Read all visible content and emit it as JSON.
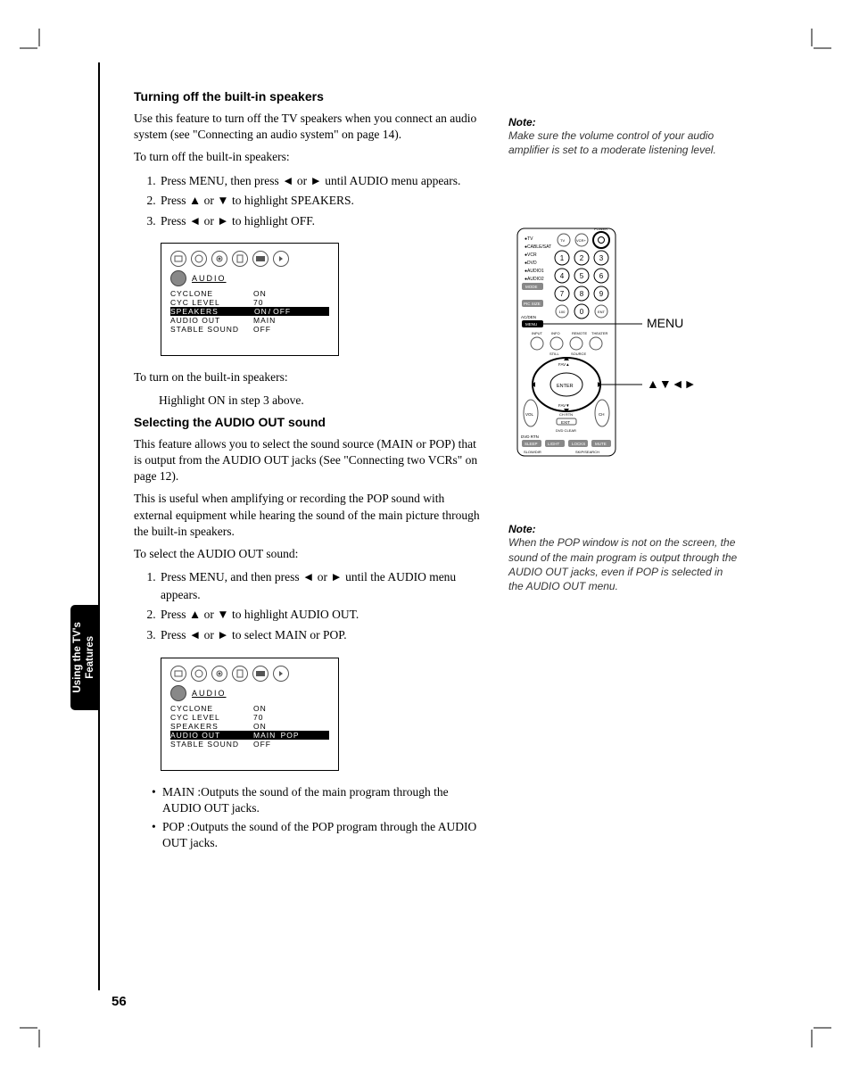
{
  "page_number": "56",
  "side_tab": "Using the TV's\nFeatures",
  "section1": {
    "heading": "Turning off the built-in speakers",
    "intro": "Use this feature to turn off the TV speakers when you connect an audio system (see \"Connecting an audio system\" on page 14).",
    "lead": "To turn off the built-in speakers:",
    "steps": [
      "Press MENU, then press ◄ or ► until AUDIO menu appears.",
      "Press ▲ or ▼ to highlight SPEAKERS.",
      "Press ◄ or ► to highlight OFF."
    ],
    "osd": {
      "title": "AUDIO",
      "rows": [
        {
          "label": "CYCLONE",
          "value": "ON"
        },
        {
          "label": "CYC LEVEL",
          "value": "70"
        },
        {
          "label": "SPEAKERS",
          "value_on": "ON",
          "value_off": "OFF",
          "row_hl": true,
          "off_hl": true
        },
        {
          "label": "AUDIO OUT",
          "value": "MAIN"
        },
        {
          "label": "STABLE SOUND",
          "value": "OFF"
        }
      ]
    },
    "turnon_lead": "To turn on the built-in speakers:",
    "turnon_step": "Highlight ON in step 3 above."
  },
  "section2": {
    "heading": "Selecting the AUDIO OUT sound",
    "p1": "This feature allows you to select the sound source (MAIN or POP) that is output from the AUDIO OUT jacks (See \"Connecting two VCRs\" on page 12).",
    "p2": "This is useful when amplifying or recording the POP sound with external equipment while hearing the sound of the main picture through the built-in speakers.",
    "lead": "To select the AUDIO OUT sound:",
    "steps": [
      "Press MENU, and then press ◄ or ► until the AUDIO menu appears.",
      "Press ▲ or ▼ to highlight AUDIO OUT.",
      "Press ◄ or ► to select MAIN or POP."
    ],
    "osd": {
      "title": "AUDIO",
      "rows": [
        {
          "label": "CYCLONE",
          "value": "ON"
        },
        {
          "label": "CYC LEVEL",
          "value": "70"
        },
        {
          "label": "SPEAKERS",
          "value": "ON"
        },
        {
          "label": "AUDIO OUT",
          "value_main": "MAIN",
          "value_pop": "POP",
          "row_hl": true,
          "pop_hl": true
        },
        {
          "label": "STABLE SOUND",
          "value": "OFF"
        }
      ]
    },
    "bullets": [
      {
        "term": "MAIN :",
        "desc": "Outputs the sound of the main program through the AUDIO OUT jacks."
      },
      {
        "term": "POP   :",
        "desc": "Outputs the sound of the POP program through the AUDIO OUT jacks."
      }
    ]
  },
  "note1": {
    "label": "Note:",
    "text": "Make sure the volume control of your audio amplifier is set to a moderate listening level."
  },
  "note2": {
    "label": "Note:",
    "text": "When the POP window is not on the screen, the sound of the main program is output through the AUDIO OUT jacks, even if POP is selected in the AUDIO OUT menu."
  },
  "remote": {
    "label_menu": "MENU",
    "label_arrows": "▲▼◄►"
  }
}
